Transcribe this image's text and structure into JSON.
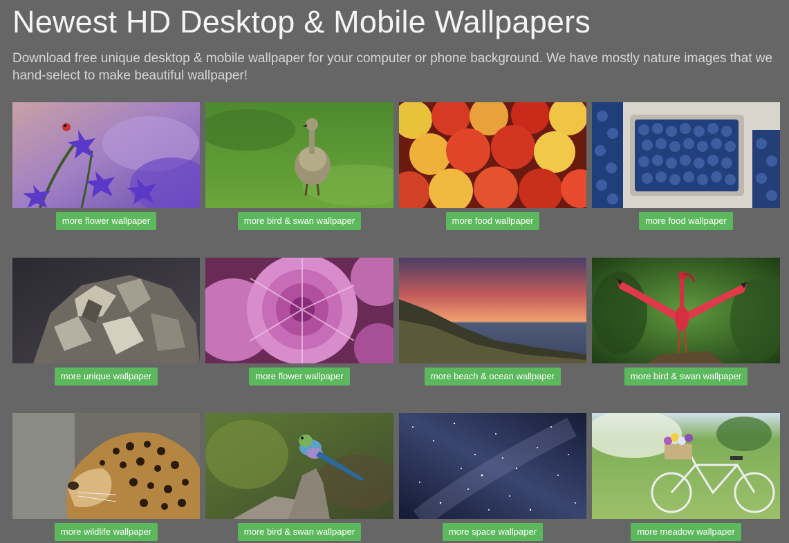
{
  "header": {
    "title": "Newest HD Desktop & Mobile Wallpapers",
    "subtitle": "Download free unique desktop & mobile wallpaper for your computer or phone background. We have mostly nature images that we hand-select to make beautiful wallpaper!"
  },
  "accent_color": "#5cb85c",
  "background_color": "#666666",
  "wallpapers": [
    {
      "subject": "purple flowers with ladybug",
      "button_label": "more flower wallpaper"
    },
    {
      "subject": "gosling on grass",
      "button_label": "more bird & swan wallpaper"
    },
    {
      "subject": "red and yellow apples",
      "button_label": "more food wallpaper"
    },
    {
      "subject": "blueberries in cartons",
      "button_label": "more food wallpaper"
    },
    {
      "subject": "pyrite crystal",
      "button_label": "more unique wallpaper"
    },
    {
      "subject": "pink chrysanthemum",
      "button_label": "more flower wallpaper"
    },
    {
      "subject": "sunset over ocean cliffs",
      "button_label": "more beach & ocean wallpaper"
    },
    {
      "subject": "scarlet ibis with open wings",
      "button_label": "more bird & swan wallpaper"
    },
    {
      "subject": "leopard portrait",
      "button_label": "more wildlife wallpaper"
    },
    {
      "subject": "lilac-breasted roller on stump",
      "button_label": "more bird & swan wallpaper"
    },
    {
      "subject": "milky way night sky",
      "button_label": "more space wallpaper"
    },
    {
      "subject": "bicycle with flower basket in meadow",
      "button_label": "more meadow wallpaper"
    }
  ]
}
